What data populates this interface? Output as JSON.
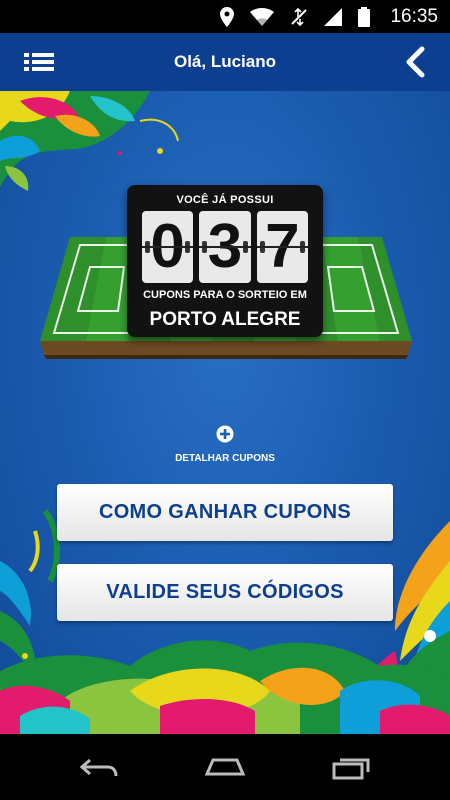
{
  "status_bar": {
    "time": "16:35",
    "icons": [
      "location-icon",
      "wifi-icon",
      "data-off-icon",
      "signal-icon",
      "battery-icon"
    ]
  },
  "header": {
    "title": "Olá, Luciano",
    "menu_icon": "list-menu-icon",
    "back_icon": "chevron-left-icon",
    "background_color": "#0c3f8f"
  },
  "scoreboard": {
    "top_text": "VOCÊ JÁ POSSUI",
    "digits": [
      "0",
      "3",
      "7"
    ],
    "bottom_text": "CUPONS PARA O SORTEIO EM",
    "city": "PORTO ALEGRE"
  },
  "detail": {
    "icon": "plus-circle-icon",
    "label": "DETALHAR CUPONS"
  },
  "buttons": {
    "how_to_earn": "COMO GANHAR CUPONS",
    "validate": "VALIDE SEUS CÓDIGOS",
    "text_color": "#0d3f8e"
  },
  "nav_bar": {
    "back_icon": "nav-back-icon",
    "home_icon": "nav-home-icon",
    "recents_icon": "nav-recents-icon"
  }
}
